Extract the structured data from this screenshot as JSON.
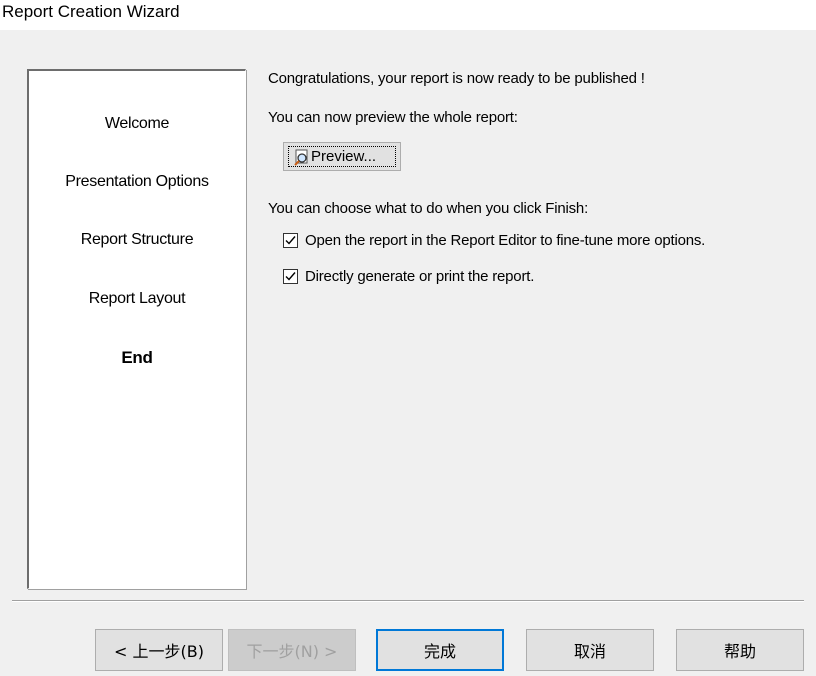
{
  "window": {
    "title": "Report Creation Wizard"
  },
  "steps": [
    {
      "label": "Welcome",
      "current": false
    },
    {
      "label": "Presentation Options",
      "current": false
    },
    {
      "label": "Report Structure",
      "current": false
    },
    {
      "label": "Report Layout",
      "current": false
    },
    {
      "label": "End",
      "current": true
    }
  ],
  "content": {
    "congrats": "Congratulations, your report is now ready to be published !",
    "preview_prompt": "You can now preview the whole report:",
    "preview_button": "Preview...",
    "finish_prompt": "You can choose what to do when you click Finish:",
    "options": [
      {
        "label": "Open the report in the Report Editor to fine-tune more options.",
        "checked": true
      },
      {
        "label": "Directly generate or print the report.",
        "checked": true
      }
    ]
  },
  "buttons": {
    "back": "< 上一步(B)",
    "next": "下一步(N) >",
    "finish": "完成",
    "cancel": "取消",
    "help": "帮助"
  }
}
